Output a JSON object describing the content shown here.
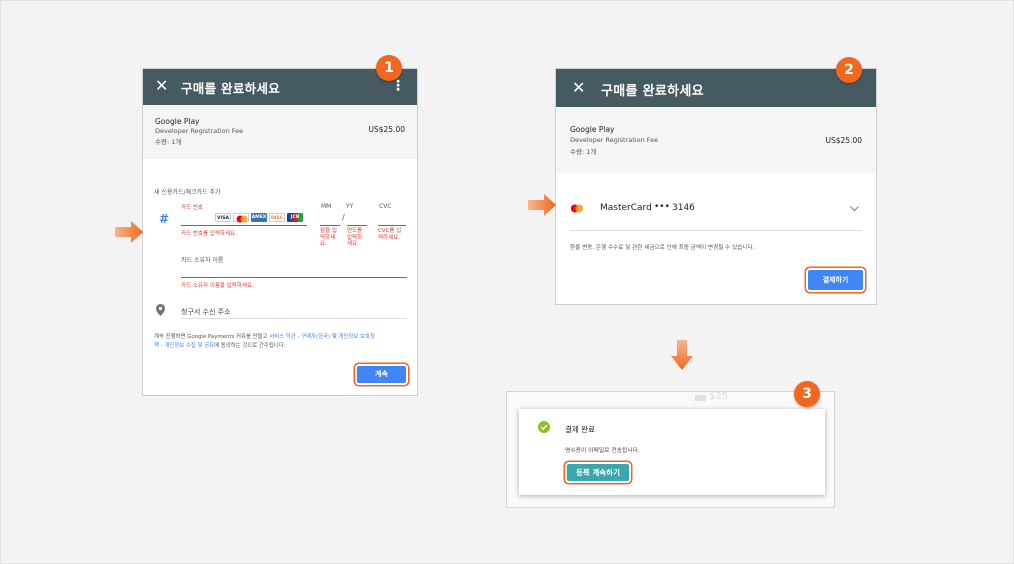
{
  "colors": {
    "header": "#465a62",
    "accent": "#f2661f",
    "button_blue": "#4285f4",
    "button_teal": "#3aa6ad",
    "error_red": "#d23f31",
    "success_green": "#8fbf21"
  },
  "step1": {
    "badge": "1",
    "title": "구매를 완료하세요",
    "summary": {
      "store": "Google Play",
      "item": "Developer Registration Fee",
      "qty": "수량: 1개",
      "price": "US$25.00"
    },
    "add_card_label": "새 신용카드/체크카드 추가",
    "card_number_label": "카드 번호",
    "card_number_error": "카드 번호를 입력하세요.",
    "mm_label": "MM",
    "yy_label": "YY",
    "slash": "/",
    "cvc_label": "CVC",
    "month_error": [
      "월을 입",
      "력하세",
      "요."
    ],
    "year_error": [
      "연도를",
      "입력하",
      "세요."
    ],
    "cvc_error": [
      "CVC를 입",
      "력하세요."
    ],
    "holder_label": "카드 소유자 이름",
    "holder_error": "카드 소유자 이름을 입력하세요.",
    "address_label": "청구서 수신 주소",
    "terms": {
      "pre": "계속 진행하면 Google Payments 커뮤를 만들고 ",
      "link1": "서비스 약관 - 구매자(한국)",
      "mid": " 및 ",
      "link2": "개인정보 보호정",
      "link2b": "책 - 개인정보 수집 및 공유",
      "post": "에 동의하는 것으로 간주됩니다."
    },
    "continue_button": "계속",
    "card_logos": [
      "VISA",
      "MC",
      "AMEX",
      "DISC",
      "JCB"
    ]
  },
  "step2": {
    "badge": "2",
    "title": "구매를 완료하세요",
    "summary": {
      "store": "Google Play",
      "item": "Developer Registration Fee",
      "qty": "수량: 1개",
      "price": "US$25.00"
    },
    "card_name": "MasterCard",
    "card_dots": "•••",
    "card_last4": "3146",
    "notice": "환율 변동, 은행 수수료 및 관련 세금으로 인해 최종 금액이 변경될 수 있습니다.",
    "pay_button": "결제하기"
  },
  "step3": {
    "badge": "3",
    "bg_price": "$25",
    "title": "결제 완료",
    "message": "영수증이 이메일로 전송됩니다.",
    "continue_button": "등록 계속하기"
  }
}
